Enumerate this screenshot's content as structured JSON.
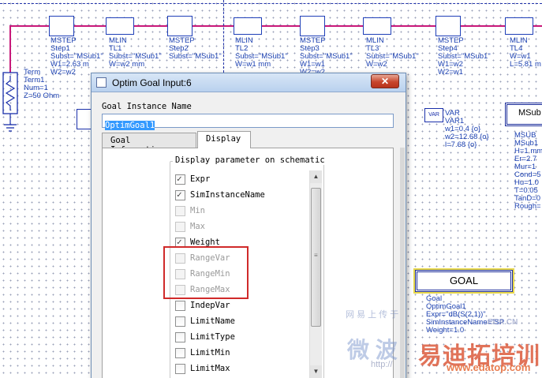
{
  "schematic": {
    "components": [
      {
        "type": "MSTEP",
        "name": "Step1",
        "p1": "Subst=\"MSub1\"",
        "p2": "W1=2.63 m",
        "p3": "W2=w2"
      },
      {
        "type": "MLIN",
        "name": "TL1",
        "p1": "Subst=\"MSub1\"",
        "p2": "W=w2 mm",
        "p3": ""
      },
      {
        "type": "MSTEP",
        "name": "Step2",
        "p1": "Subst=\"MSub1\"",
        "p2": "",
        "p3": ""
      },
      {
        "type": "MLIN",
        "name": "TL2",
        "p1": "Subst=\"MSub1\"",
        "p2": "W=w1 mm",
        "p3": ""
      },
      {
        "type": "MSTEP",
        "name": "Step3",
        "p1": "Subst=\"MSub1\"",
        "p2": "W1=w1",
        "p3": "W2=w2"
      },
      {
        "type": "MLIN",
        "name": "TL3",
        "p1": "Subst=\"MSub1\"",
        "p2": "W=w2",
        "p3": ""
      },
      {
        "type": "MSTEP",
        "name": "Step4",
        "p1": "Subst=\"MSub1\"",
        "p2": "W1=w2",
        "p3": "W2=w1"
      },
      {
        "type": "MLIN",
        "name": "TL4",
        "p1": "Subst=\"MSub1\"",
        "p2": "W=w1",
        "p3": "L=5.81 m"
      }
    ],
    "term": {
      "type": "Term",
      "name": "Term1",
      "num": "Num=1",
      "z": "Z=50 Ohm"
    },
    "var": {
      "icon_label": "VAR",
      "type": "VAR",
      "name": "VAR1",
      "w1": "w1=0.4 {o}",
      "w2": "w2=12.68 {o}",
      "l": "l=7.68 {o}"
    },
    "msub": {
      "box_label": "MSub",
      "type": "MSUB",
      "name": "MSub1",
      "h": "H=1 mm",
      "er": "Er=2.7",
      "mur": "Mur=1",
      "cond": "Cond=5",
      "hu": "Hu=1.0",
      "t": "T=0.05",
      "tand": "TanD=0",
      "rough": "Rough="
    },
    "goal": {
      "box_label": "GOAL",
      "type": "Goal",
      "name": "OptimGoal1",
      "expr": "Expr=\"dB(S(2,1))\"",
      "sim": "SimInstanceName=\"SP",
      "weight": "Weight=1.0"
    }
  },
  "dialog": {
    "title": "Optim Goal Input:6",
    "close_label": "✕",
    "instance_label": "Goal Instance Name",
    "instance_value": "OptimGoal1",
    "tabs": [
      {
        "label": "Goal Information",
        "active": false
      },
      {
        "label": "Display",
        "active": true
      }
    ],
    "group_title": "Display parameter on schematic",
    "params": [
      {
        "label": "Expr",
        "checked": true,
        "enabled": true
      },
      {
        "label": "SimInstanceName",
        "checked": true,
        "enabled": true
      },
      {
        "label": "Min",
        "checked": false,
        "enabled": false
      },
      {
        "label": "Max",
        "checked": false,
        "enabled": false
      },
      {
        "label": "Weight",
        "checked": true,
        "enabled": true
      },
      {
        "label": "RangeVar",
        "checked": false,
        "enabled": false
      },
      {
        "label": "RangeMin",
        "checked": false,
        "enabled": false
      },
      {
        "label": "RangeMax",
        "checked": false,
        "enabled": false
      },
      {
        "label": "IndepVar",
        "checked": false,
        "enabled": true
      },
      {
        "label": "LimitName",
        "checked": false,
        "enabled": true
      },
      {
        "label": "LimitType",
        "checked": false,
        "enabled": true
      },
      {
        "label": "LimitMin",
        "checked": false,
        "enabled": true
      },
      {
        "label": "LimitMax",
        "checked": false,
        "enabled": true
      }
    ]
  },
  "watermark": {
    "cn_top": "网 易 上 传 于",
    "cn_mid": "微 波",
    "site_text": "EDA.CN",
    "brand": "易迪拓培训",
    "url": "http://",
    "url2": "www.edatop.com"
  }
}
